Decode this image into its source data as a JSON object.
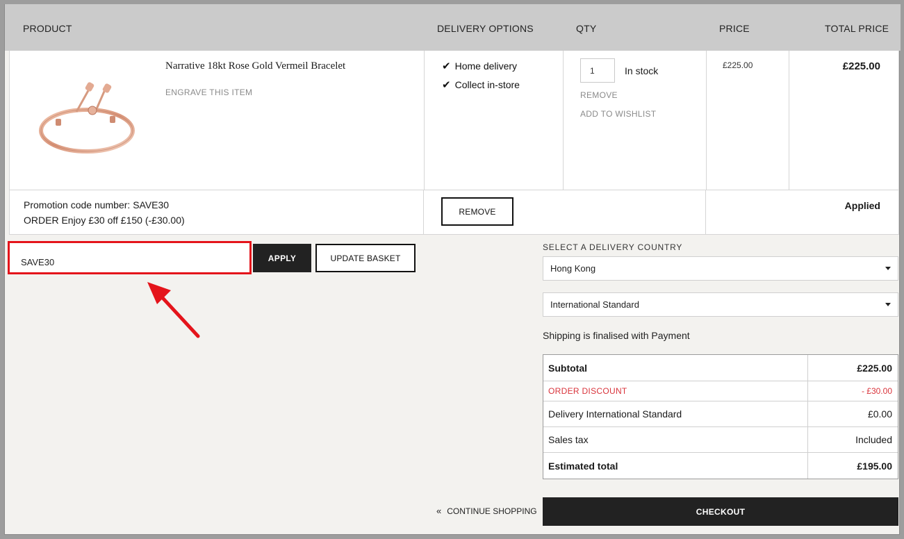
{
  "table_header": {
    "product": "PRODUCT",
    "delivery_options": "DELIVERY OPTIONS",
    "qty": "QTY",
    "price": "PRICE",
    "total_price": "TOTAL PRICE"
  },
  "item": {
    "name": "Narrative 18kt Rose Gold Vermeil Bracelet",
    "engrave": "ENGRAVE THIS ITEM",
    "delivery": [
      "Home delivery",
      "Collect in-store"
    ],
    "qty": "1",
    "stock": "In stock",
    "remove": "REMOVE",
    "wishlist": "ADD TO WISHLIST",
    "price": "£225.00",
    "total": "£225.00"
  },
  "promotion": {
    "line1": "Promotion code number: SAVE30",
    "line2": "ORDER Enjoy £30 off £150 (-£30.00)",
    "remove_button": "REMOVE",
    "status": "Applied"
  },
  "coupon": {
    "value": "SAVE30",
    "apply_button": "APPLY",
    "update_button": "UPDATE BASKET"
  },
  "delivery": {
    "country_label": "SELECT A DELIVERY COUNTRY",
    "country_value": "Hong Kong",
    "method_value": "International Standard",
    "note": "Shipping is finalised with Payment"
  },
  "summary": {
    "subtotal_label": "Subtotal",
    "subtotal_value": "£225.00",
    "discount_label": "ORDER DISCOUNT",
    "discount_value": "- £30.00",
    "delivery_label": "Delivery International Standard",
    "delivery_value": "£0.00",
    "tax_label": "Sales tax",
    "tax_value": "Included",
    "total_label": "Estimated total",
    "total_value": "£195.00"
  },
  "actions": {
    "continue": "CONTINUE SHOPPING",
    "checkout": "CHECKOUT"
  },
  "colors": {
    "highlight": "#e4141b",
    "discount": "#d9333b",
    "dark_button": "#222222"
  },
  "icons": {
    "check": "check-icon",
    "caret": "caret-down-icon",
    "chevrons": "double-chevron-left-icon",
    "arrow": "red-arrow-annotation"
  }
}
